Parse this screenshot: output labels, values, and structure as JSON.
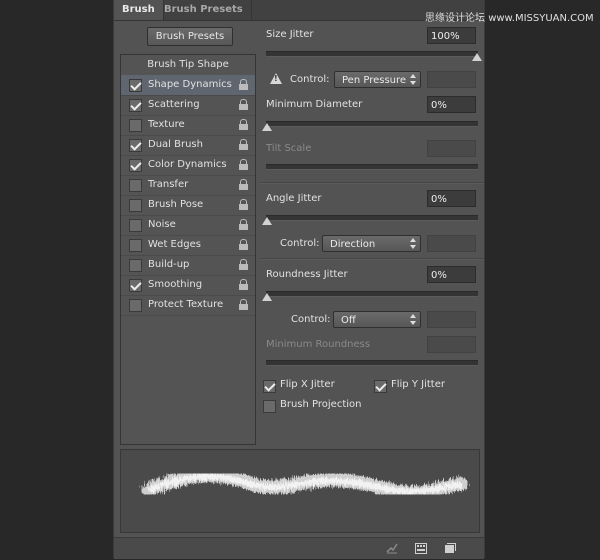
{
  "tabs": {
    "brush": "Brush",
    "presets": "Brush Presets"
  },
  "watermark": {
    "text": "思缘设计论坛",
    "site": "www.MISSYUAN.COM"
  },
  "left": {
    "presets_button": "Brush Presets",
    "tip_shape": "Brush Tip Shape",
    "items": [
      {
        "label": "Shape Dynamics",
        "checked": true
      },
      {
        "label": "Scattering",
        "checked": true
      },
      {
        "label": "Texture",
        "checked": false
      },
      {
        "label": "Dual Brush",
        "checked": true
      },
      {
        "label": "Color Dynamics",
        "checked": true
      },
      {
        "label": "Transfer",
        "checked": false
      },
      {
        "label": "Brush Pose",
        "checked": false
      },
      {
        "label": "Noise",
        "checked": false
      },
      {
        "label": "Wet Edges",
        "checked": false
      },
      {
        "label": "Build-up",
        "checked": false
      },
      {
        "label": "Smoothing",
        "checked": true
      },
      {
        "label": "Protect Texture",
        "checked": false
      }
    ]
  },
  "right": {
    "size_jitter": {
      "label": "Size Jitter",
      "value": "100%"
    },
    "control1": {
      "label": "Control:",
      "value": "Pen Pressure"
    },
    "min_diameter": {
      "label": "Minimum Diameter",
      "value": "0%"
    },
    "tilt_scale": {
      "label": "Tilt Scale"
    },
    "angle_jitter": {
      "label": "Angle Jitter",
      "value": "0%"
    },
    "control2": {
      "label": "Control:",
      "value": "Direction"
    },
    "roundness_jitter": {
      "label": "Roundness Jitter",
      "value": "0%"
    },
    "control3": {
      "label": "Control:",
      "value": "Off"
    },
    "min_roundness": {
      "label": "Minimum Roundness"
    },
    "flip_x": {
      "label": "Flip X Jitter",
      "checked": true
    },
    "flip_y": {
      "label": "Flip Y Jitter",
      "checked": true
    },
    "projection": {
      "label": "Brush Projection",
      "checked": false
    }
  }
}
